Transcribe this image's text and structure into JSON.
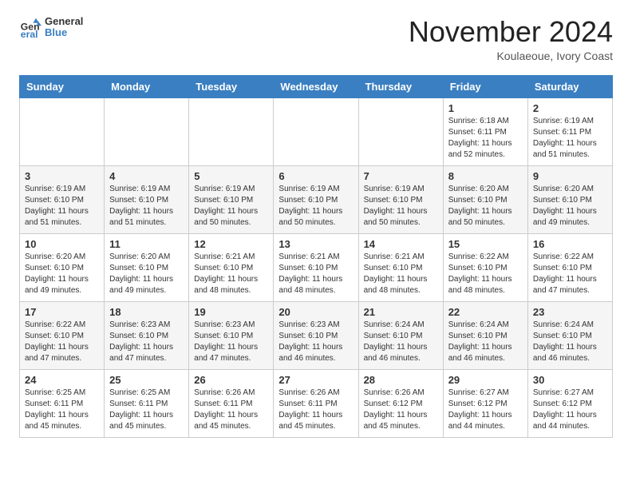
{
  "header": {
    "logo_line1": "General",
    "logo_line2": "Blue",
    "month": "November 2024",
    "location": "Koulaeoue, Ivory Coast"
  },
  "weekdays": [
    "Sunday",
    "Monday",
    "Tuesday",
    "Wednesday",
    "Thursday",
    "Friday",
    "Saturday"
  ],
  "weeks": [
    [
      {
        "day": "",
        "info": ""
      },
      {
        "day": "",
        "info": ""
      },
      {
        "day": "",
        "info": ""
      },
      {
        "day": "",
        "info": ""
      },
      {
        "day": "",
        "info": ""
      },
      {
        "day": "1",
        "info": "Sunrise: 6:18 AM\nSunset: 6:11 PM\nDaylight: 11 hours\nand 52 minutes."
      },
      {
        "day": "2",
        "info": "Sunrise: 6:19 AM\nSunset: 6:11 PM\nDaylight: 11 hours\nand 51 minutes."
      }
    ],
    [
      {
        "day": "3",
        "info": "Sunrise: 6:19 AM\nSunset: 6:10 PM\nDaylight: 11 hours\nand 51 minutes."
      },
      {
        "day": "4",
        "info": "Sunrise: 6:19 AM\nSunset: 6:10 PM\nDaylight: 11 hours\nand 51 minutes."
      },
      {
        "day": "5",
        "info": "Sunrise: 6:19 AM\nSunset: 6:10 PM\nDaylight: 11 hours\nand 50 minutes."
      },
      {
        "day": "6",
        "info": "Sunrise: 6:19 AM\nSunset: 6:10 PM\nDaylight: 11 hours\nand 50 minutes."
      },
      {
        "day": "7",
        "info": "Sunrise: 6:19 AM\nSunset: 6:10 PM\nDaylight: 11 hours\nand 50 minutes."
      },
      {
        "day": "8",
        "info": "Sunrise: 6:20 AM\nSunset: 6:10 PM\nDaylight: 11 hours\nand 50 minutes."
      },
      {
        "day": "9",
        "info": "Sunrise: 6:20 AM\nSunset: 6:10 PM\nDaylight: 11 hours\nand 49 minutes."
      }
    ],
    [
      {
        "day": "10",
        "info": "Sunrise: 6:20 AM\nSunset: 6:10 PM\nDaylight: 11 hours\nand 49 minutes."
      },
      {
        "day": "11",
        "info": "Sunrise: 6:20 AM\nSunset: 6:10 PM\nDaylight: 11 hours\nand 49 minutes."
      },
      {
        "day": "12",
        "info": "Sunrise: 6:21 AM\nSunset: 6:10 PM\nDaylight: 11 hours\nand 48 minutes."
      },
      {
        "day": "13",
        "info": "Sunrise: 6:21 AM\nSunset: 6:10 PM\nDaylight: 11 hours\nand 48 minutes."
      },
      {
        "day": "14",
        "info": "Sunrise: 6:21 AM\nSunset: 6:10 PM\nDaylight: 11 hours\nand 48 minutes."
      },
      {
        "day": "15",
        "info": "Sunrise: 6:22 AM\nSunset: 6:10 PM\nDaylight: 11 hours\nand 48 minutes."
      },
      {
        "day": "16",
        "info": "Sunrise: 6:22 AM\nSunset: 6:10 PM\nDaylight: 11 hours\nand 47 minutes."
      }
    ],
    [
      {
        "day": "17",
        "info": "Sunrise: 6:22 AM\nSunset: 6:10 PM\nDaylight: 11 hours\nand 47 minutes."
      },
      {
        "day": "18",
        "info": "Sunrise: 6:23 AM\nSunset: 6:10 PM\nDaylight: 11 hours\nand 47 minutes."
      },
      {
        "day": "19",
        "info": "Sunrise: 6:23 AM\nSunset: 6:10 PM\nDaylight: 11 hours\nand 47 minutes."
      },
      {
        "day": "20",
        "info": "Sunrise: 6:23 AM\nSunset: 6:10 PM\nDaylight: 11 hours\nand 46 minutes."
      },
      {
        "day": "21",
        "info": "Sunrise: 6:24 AM\nSunset: 6:10 PM\nDaylight: 11 hours\nand 46 minutes."
      },
      {
        "day": "22",
        "info": "Sunrise: 6:24 AM\nSunset: 6:10 PM\nDaylight: 11 hours\nand 46 minutes."
      },
      {
        "day": "23",
        "info": "Sunrise: 6:24 AM\nSunset: 6:10 PM\nDaylight: 11 hours\nand 46 minutes."
      }
    ],
    [
      {
        "day": "24",
        "info": "Sunrise: 6:25 AM\nSunset: 6:11 PM\nDaylight: 11 hours\nand 45 minutes."
      },
      {
        "day": "25",
        "info": "Sunrise: 6:25 AM\nSunset: 6:11 PM\nDaylight: 11 hours\nand 45 minutes."
      },
      {
        "day": "26",
        "info": "Sunrise: 6:26 AM\nSunset: 6:11 PM\nDaylight: 11 hours\nand 45 minutes."
      },
      {
        "day": "27",
        "info": "Sunrise: 6:26 AM\nSunset: 6:11 PM\nDaylight: 11 hours\nand 45 minutes."
      },
      {
        "day": "28",
        "info": "Sunrise: 6:26 AM\nSunset: 6:12 PM\nDaylight: 11 hours\nand 45 minutes."
      },
      {
        "day": "29",
        "info": "Sunrise: 6:27 AM\nSunset: 6:12 PM\nDaylight: 11 hours\nand 44 minutes."
      },
      {
        "day": "30",
        "info": "Sunrise: 6:27 AM\nSunset: 6:12 PM\nDaylight: 11 hours\nand 44 minutes."
      }
    ]
  ]
}
